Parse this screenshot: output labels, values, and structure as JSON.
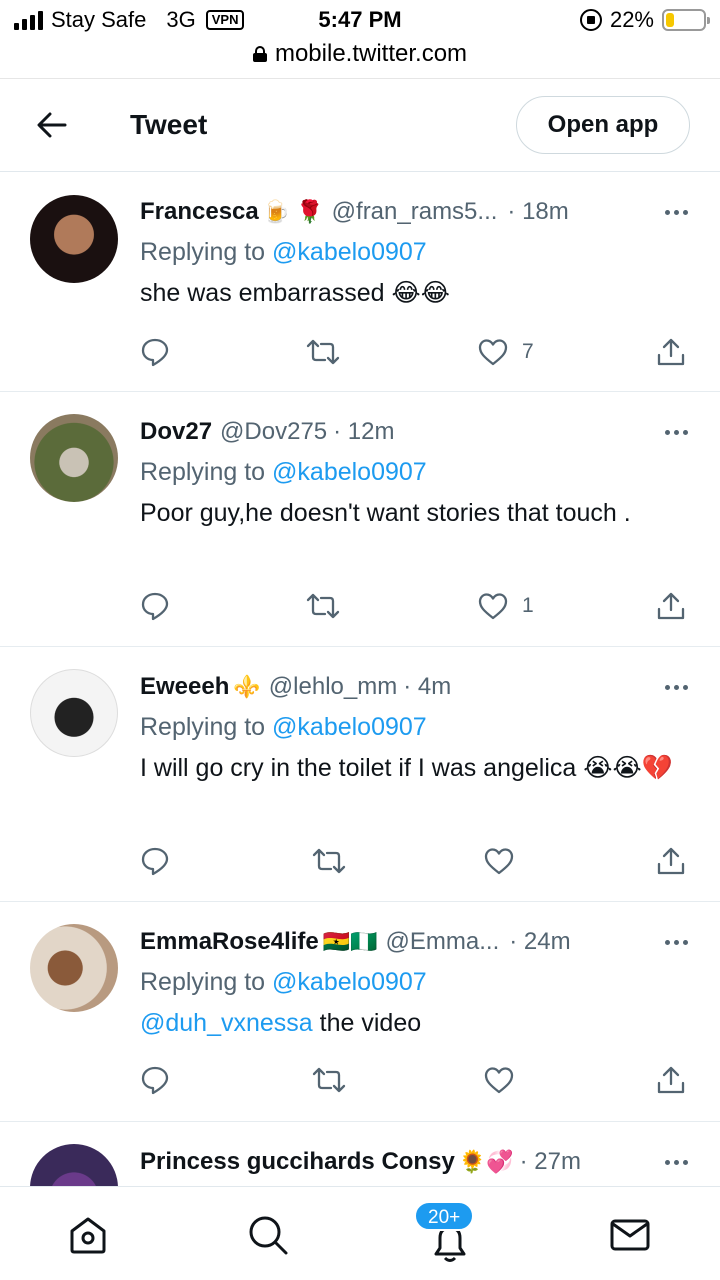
{
  "status_bar": {
    "carrier": "Stay Safe",
    "network": "3G",
    "vpn": "VPN",
    "time": "5:47 PM",
    "battery": "22%",
    "battery_level": 0.22,
    "battery_color": "#f6c700"
  },
  "browser": {
    "url": "mobile.twitter.com"
  },
  "header": {
    "back_icon": "arrow-left-icon",
    "title": "Tweet",
    "open_app_label": "Open app"
  },
  "colors": {
    "link": "#1d9bf0",
    "secondary": "#536471",
    "text": "#0f1419"
  },
  "tweets": [
    {
      "name": "Francesca",
      "name_emoji": "🍺 🌹",
      "handle": "@fran_rams5...",
      "time": "· 18m",
      "reply_prefix": "Replying to",
      "reply_to": "@kabelo0907",
      "text": "she was embarrassed 😂😂",
      "likes": "7"
    },
    {
      "name": "Dov27",
      "name_emoji": "",
      "handle": "@Dov275",
      "time": "· 12m",
      "reply_prefix": "Replying to",
      "reply_to": "@kabelo0907",
      "text": "Poor guy,he doesn't want stories that touch .",
      "likes": "1"
    },
    {
      "name": "Eweeeh",
      "name_emoji": "⚜️",
      "handle": "@lehlo_mm",
      "time": "· 4m",
      "reply_prefix": "Replying to",
      "reply_to": "@kabelo0907",
      "text": "I will go cry in the toilet if I was angelica 😭😭💔",
      "likes": ""
    },
    {
      "name": "EmmaRose4life",
      "name_emoji": "🇬🇭🇳🇬",
      "handle": "@Emma...",
      "time": "· 24m",
      "reply_prefix": "Replying to",
      "reply_to": "@kabelo0907",
      "text_mention": "@duh_vxnessa",
      "text": " the video",
      "likes": ""
    },
    {
      "name": "Princess guccihards Consy",
      "name_emoji": "🌻💞",
      "handle": "",
      "time": "· 27m"
    }
  ],
  "bottom_nav": {
    "items": [
      "home-icon",
      "search-icon",
      "notifications-icon",
      "messages-icon"
    ],
    "notifications_badge": "20+"
  }
}
